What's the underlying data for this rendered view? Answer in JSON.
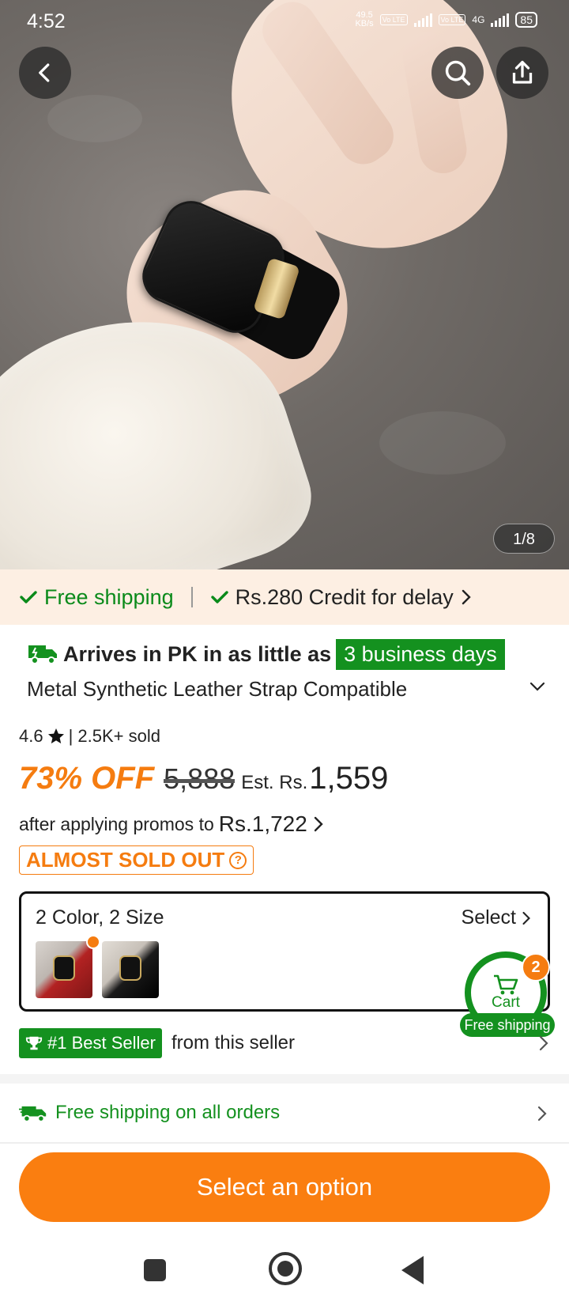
{
  "status_bar": {
    "time": "4:52",
    "net_speed": "49.5",
    "net_unit": "KB/s",
    "sim1": "Vo LTE",
    "sim2": "Vo LTE",
    "gen": "4G",
    "battery": "85"
  },
  "gallery": {
    "counter": "1/8"
  },
  "shipping_strip": {
    "free_shipping": "Free shipping",
    "credit": "Rs.280 Credit for delay"
  },
  "delivery": {
    "arrives_text": "Arrives in PK in as little as",
    "days_badge": "3 business days"
  },
  "product": {
    "title": "Metal Synthetic Leather Strap Compatible",
    "rating": "4.6",
    "sold": "| 2.5K+ sold",
    "discount": "73% OFF",
    "original_price": "5,888",
    "est_label": "Est. Rs.",
    "final_price": "1,559",
    "promo_text": "after applying promos to",
    "promo_price": "Rs.1,722",
    "stock_badge": "ALMOST SOLD OUT"
  },
  "variants": {
    "summary": "2 Color, 2 Size",
    "select_label": "Select",
    "swatches": [
      "red-strap",
      "black-strap"
    ]
  },
  "cart": {
    "label": "Cart",
    "count": "2",
    "free_shipping": "Free shipping"
  },
  "seller": {
    "badge": "#1 Best Seller",
    "text": "from this seller"
  },
  "free_shipping_row": {
    "text": "Free shipping on all orders"
  },
  "cta": {
    "label": "Select an option"
  },
  "colors": {
    "accent_orange": "#fa7e10",
    "accent_green": "#14911f",
    "strip_bg": "#fdefe3"
  }
}
